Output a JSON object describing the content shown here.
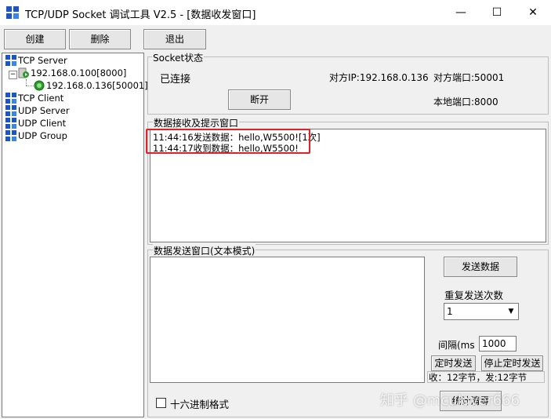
{
  "window": {
    "title": "TCP/UDP Socket 调试工具 V2.5 - [数据收发窗口]",
    "minimize_glyph": "—",
    "maximize_glyph": "☐",
    "close_glyph": "✕"
  },
  "toolbar": {
    "create_label": "创建",
    "delete_label": "删除",
    "exit_label": "退出"
  },
  "tree": {
    "items": [
      {
        "label": "TCP Server",
        "icon": "network-grid-icon"
      },
      {
        "label": "192.168.0.100[8000]",
        "icon": "server-play-icon"
      },
      {
        "label": "192.168.0.136[50001]",
        "icon": "connection-green-icon"
      },
      {
        "label": "TCP Client",
        "icon": "network-grid-icon"
      },
      {
        "label": "UDP Server",
        "icon": "network-grid-icon"
      },
      {
        "label": "UDP Client",
        "icon": "network-grid-icon"
      },
      {
        "label": "UDP Group",
        "icon": "network-grid-icon"
      }
    ]
  },
  "socket_status": {
    "group_label": "Socket状态",
    "state": "已连接",
    "peer_ip": "对方IP:192.168.0.136",
    "peer_port": "对方端口:50001",
    "local_port": "本地端口:8000",
    "disconnect_label": "断开"
  },
  "receive": {
    "group_label": "数据接收及提示窗口",
    "lines": [
      "11:44:16发送数据：hello,W5500![1次]",
      "11:44:17收到数据：hello,W5500!"
    ],
    "highlight_color": "#e0202a"
  },
  "send": {
    "group_label": "数据发送窗口(文本模式)",
    "content": "",
    "send_button_label": "发送数据",
    "repeat_label": "重复发送次数",
    "repeat_value": "1",
    "interval_label": "间隔(ms",
    "interval_value": "1000",
    "timed_send_label": "定时发送",
    "stop_timed_label": "停止定时发送",
    "stats_text": "收：12字节，发:12字节",
    "hex_label": "十六进制格式",
    "hex_checked": false,
    "stats_clear_label": "统计清零"
  },
  "watermark": {
    "text": "知乎 @mculover666"
  }
}
